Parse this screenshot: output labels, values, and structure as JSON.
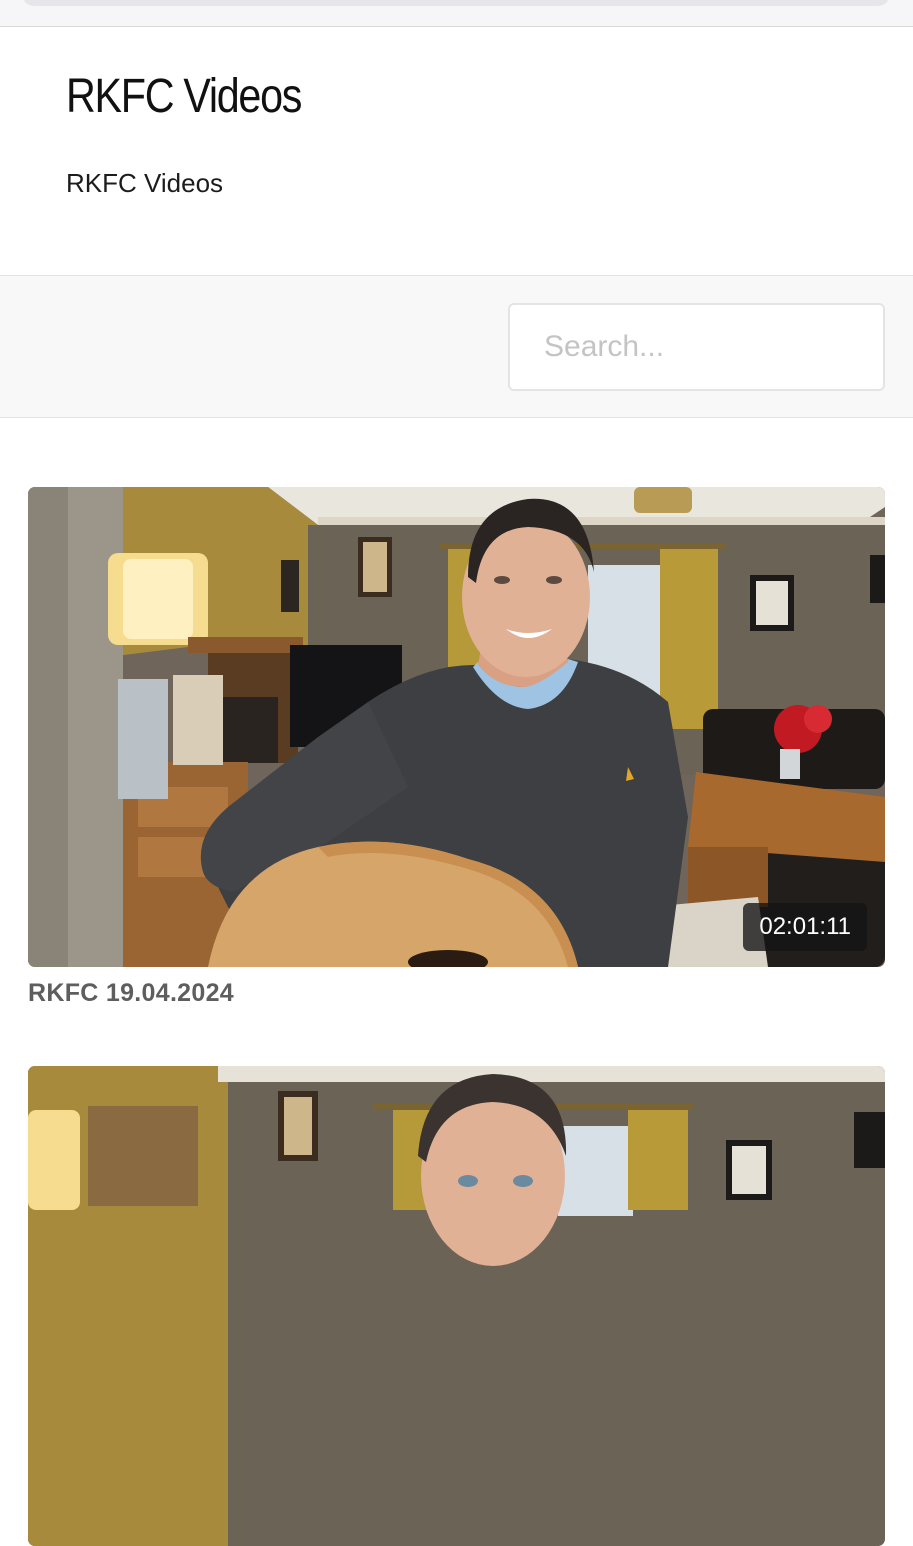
{
  "header": {
    "title": "RKFC Videos",
    "subtitle": "RKFC Videos"
  },
  "search": {
    "placeholder": "Search..."
  },
  "videos": [
    {
      "title": "RKFC 19.04.2024",
      "duration": "02:01:11"
    },
    {
      "title": "",
      "duration": ""
    }
  ],
  "colors": {
    "background": "#ffffff",
    "band": "#f8f8f8",
    "video_title": "#5e5e5e",
    "duration_badge": "#141414"
  }
}
